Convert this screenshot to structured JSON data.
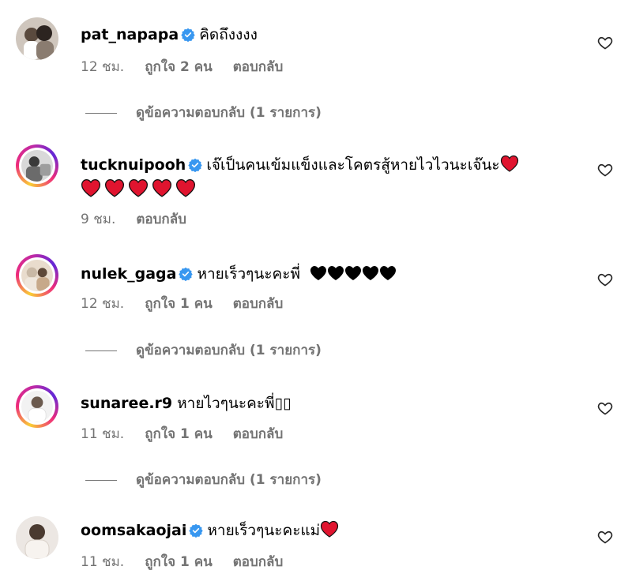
{
  "colors": {
    "verified": "#3897f0",
    "meta_text": "#737373",
    "red_heart": "#e0142f",
    "black_heart": "#000000"
  },
  "comments": [
    {
      "username": "pat_napapa",
      "verified": true,
      "text": "คิดถึงงงง",
      "time": "12 ชม.",
      "likes": "ถูกใจ 2 คน",
      "reply": "ตอบกลับ",
      "view_replies": "ดูข้อความตอบกลับ (1 รายการ)"
    },
    {
      "username": "tucknuipooh",
      "verified": true,
      "text": "เจ๊เป็นคนเข้มแข็งและโคตรสู้หายไวไวนะเจ๊นะ",
      "trailing_hearts": "❤",
      "second_line_hearts": "❤❤❤❤❤",
      "time": "9 ชม.",
      "reply": "ตอบกลับ"
    },
    {
      "username": "nulek_gaga",
      "verified": true,
      "text": "หายเร็วๆนะคะพี่",
      "trailing_hearts": "🖤🖤🖤🖤🖤",
      "time": "12 ชม.",
      "likes": "ถูกใจ 1 คน",
      "reply": "ตอบกลับ",
      "view_replies": "ดูข้อความตอบกลับ (1 รายการ)"
    },
    {
      "username": "sunaree.r9",
      "verified": false,
      "text": "หายไวๆนะคะพี่▯▯",
      "time": "11 ชม.",
      "likes": "ถูกใจ 1 คน",
      "reply": "ตอบกลับ",
      "view_replies": "ดูข้อความตอบกลับ (1 รายการ)"
    },
    {
      "username": "oomsakaojai",
      "verified": true,
      "text": "หายเร็วๆนะคะแม่",
      "trailing_hearts": "❤",
      "time": "11 ชม.",
      "likes": "ถูกใจ 1 คน",
      "reply": "ตอบกลับ"
    }
  ]
}
